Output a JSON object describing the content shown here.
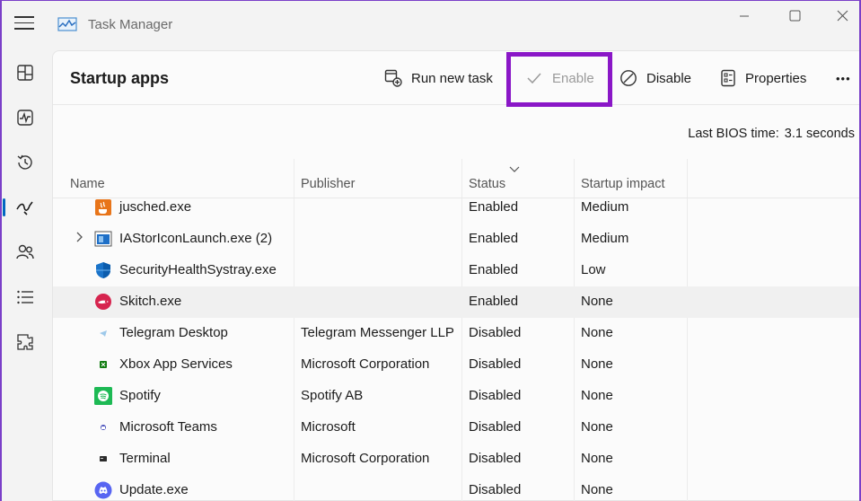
{
  "window": {
    "title": "Task Manager"
  },
  "nav": {
    "items": [
      {
        "name": "processes",
        "icon": "processes-icon"
      },
      {
        "name": "performance",
        "icon": "performance-icon"
      },
      {
        "name": "app-history",
        "icon": "history-icon"
      },
      {
        "name": "startup-apps",
        "icon": "startup-icon",
        "active": true
      },
      {
        "name": "users",
        "icon": "users-icon"
      },
      {
        "name": "details",
        "icon": "details-icon"
      },
      {
        "name": "services",
        "icon": "services-icon"
      }
    ]
  },
  "page": {
    "title": "Startup apps"
  },
  "toolbar": {
    "run_new_task": "Run new task",
    "enable": "Enable",
    "disable": "Disable",
    "properties": "Properties",
    "more": "•••"
  },
  "bios": {
    "label": "Last BIOS time:",
    "value": "3.1 seconds"
  },
  "table": {
    "columns": {
      "name": "Name",
      "publisher": "Publisher",
      "status": "Status",
      "impact": "Startup impact"
    },
    "rows": [
      {
        "name": "jusched.exe",
        "publisher": "",
        "status": "Enabled",
        "impact": "Medium",
        "icon": "java-icon"
      },
      {
        "name": "IAStorIconLaunch.exe (2)",
        "publisher": "",
        "status": "Enabled",
        "impact": "Medium",
        "icon": "intel-storage-icon",
        "expandable": true
      },
      {
        "name": "SecurityHealthSystray.exe",
        "publisher": "",
        "status": "Enabled",
        "impact": "Low",
        "icon": "shield-icon"
      },
      {
        "name": "Skitch.exe",
        "publisher": "",
        "status": "Enabled",
        "impact": "None",
        "icon": "skitch-icon",
        "selected": true
      },
      {
        "name": "Telegram Desktop",
        "publisher": "Telegram Messenger LLP",
        "status": "Disabled",
        "impact": "None",
        "icon": "telegram-icon"
      },
      {
        "name": "Xbox App Services",
        "publisher": "Microsoft Corporation",
        "status": "Disabled",
        "impact": "None",
        "icon": "xbox-icon"
      },
      {
        "name": "Spotify",
        "publisher": "Spotify AB",
        "status": "Disabled",
        "impact": "None",
        "icon": "spotify-icon"
      },
      {
        "name": "Microsoft Teams",
        "publisher": "Microsoft",
        "status": "Disabled",
        "impact": "None",
        "icon": "teams-icon"
      },
      {
        "name": "Terminal",
        "publisher": "Microsoft Corporation",
        "status": "Disabled",
        "impact": "None",
        "icon": "terminal-icon"
      },
      {
        "name": "Update.exe",
        "publisher": "",
        "status": "Disabled",
        "impact": "None",
        "icon": "discord-icon"
      }
    ]
  },
  "colors": {
    "accent": "#0067c0",
    "highlight": "#8a17c7"
  }
}
